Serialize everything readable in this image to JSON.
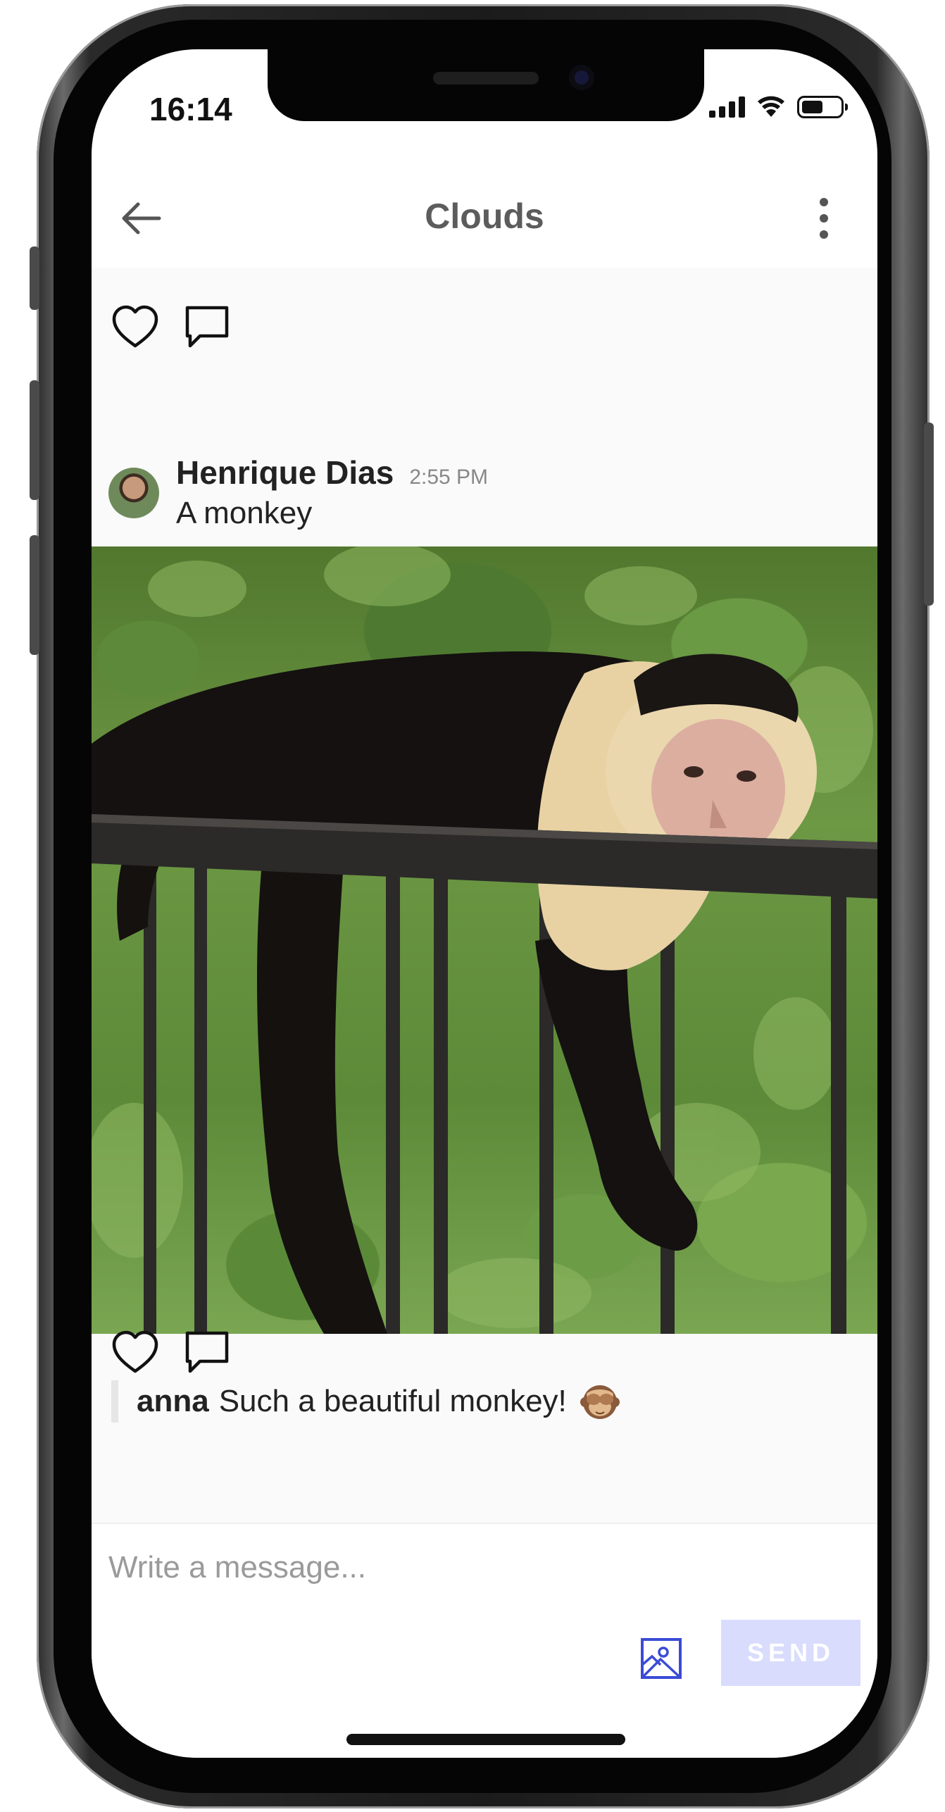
{
  "status_bar": {
    "time": "16:14"
  },
  "header": {
    "title": "Clouds"
  },
  "post": {
    "author": "Henrique Dias",
    "time": "2:55 PM",
    "caption": "A monkey"
  },
  "comment": {
    "author": "anna",
    "text": "Such a beautiful monkey!"
  },
  "composer": {
    "placeholder": "Write a message...",
    "send_label": "SEND"
  },
  "colors": {
    "send_button_disabled": "#d9dcfc",
    "image_icon": "#3b4bd6",
    "title_text": "#5c5c5c"
  }
}
